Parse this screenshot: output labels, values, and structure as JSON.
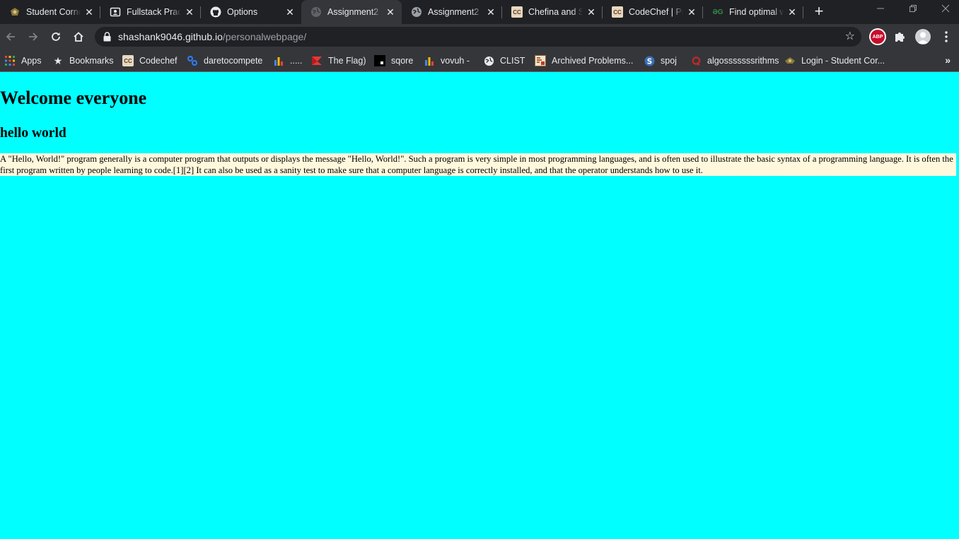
{
  "browser": {
    "tabs": [
      {
        "title": "Student Corner",
        "favicon": "student-crest-icon"
      },
      {
        "title": "Fullstack Practice",
        "favicon": "contact-card-icon"
      },
      {
        "title": "Options",
        "favicon": "github-icon"
      },
      {
        "title": "Assignment2",
        "favicon": "globe-icon",
        "active": true
      },
      {
        "title": "Assignment2",
        "favicon": "globe-icon"
      },
      {
        "title": "Chefina and Swap",
        "favicon": "codechef-icon"
      },
      {
        "title": "CodeChef | Practice",
        "favicon": "codechef-icon"
      },
      {
        "title": "Find optimal weights",
        "favicon": "gfg-icon"
      }
    ],
    "new_tab_label": "+",
    "url": {
      "host": "shashank9046.github.io",
      "path": "/personalwebpage/"
    },
    "extensions": {
      "abp_label": "ABP"
    },
    "bookmarks": [
      {
        "label": "Apps",
        "icon": "apps-grid-icon"
      },
      {
        "label": "Bookmarks",
        "icon": "star-icon"
      },
      {
        "label": "Codechef",
        "icon": "codechef-icon"
      },
      {
        "label": "daretocompete",
        "icon": "daretocompete-icon"
      },
      {
        "label": ".....",
        "icon": "bar-chart-icon"
      },
      {
        "label": "The Flag)",
        "icon": "flag-icon"
      },
      {
        "label": "sqore",
        "icon": "sqore-icon"
      },
      {
        "label": "vovuh -",
        "icon": "bar-chart-icon"
      },
      {
        "label": "CLIST",
        "icon": "globe-icon"
      },
      {
        "label": "Archived Problems...",
        "icon": "archive-icon"
      },
      {
        "label": "spoj",
        "icon": "spoj-icon"
      },
      {
        "label": "algosssssssrithms",
        "icon": "quora-icon"
      },
      {
        "label": "Login - Student Cor...",
        "icon": "student-crest-icon"
      }
    ],
    "bookmarks_overflow": "»",
    "colors": {
      "tabstrip": "#202124",
      "toolbar": "#35363a",
      "omnibox": "#202124"
    }
  },
  "page": {
    "heading": "Welcome everyone",
    "subheading": "hello world",
    "paragraph": "A \"Hello, World!\" program generally is a computer program that outputs or displays the message \"Hello, World!\". Such a program is very simple in most programming languages, and is often used to illustrate the basic syntax of a programming language. It is often the first program written by people learning to code.[1][2] It can also be used as a sanity test to make sure that a computer language is correctly installed, and that the operator understands how to use it.",
    "colors": {
      "background": "#00ffff",
      "paragraph_background": "#fff8dc"
    }
  }
}
